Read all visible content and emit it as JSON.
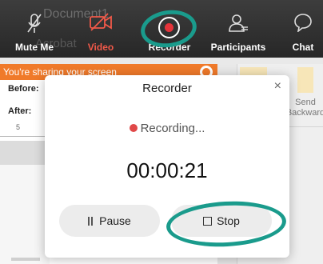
{
  "toolbar": {
    "ghost_title": "Document1",
    "ghost_sub": "Acrobat",
    "buttons": {
      "mute": "Mute Me",
      "video": "Video",
      "recorder": "Recorder",
      "participants": "Participants",
      "chat": "Chat"
    },
    "video_label_color": "#f15949",
    "highlight_color": "#1a9b8c"
  },
  "document": {
    "share_banner": "You're sharing your screen",
    "before_label": "Before:",
    "after_label": "After:",
    "ruler_number": "5",
    "send_backward": "Send Backward"
  },
  "recorder_dialog": {
    "title": "Recorder",
    "close_symbol": "×",
    "status": "Recording...",
    "status_color": "#e04848",
    "elapsed": "00:00:21",
    "pause_label": "Pause",
    "stop_label": "Stop"
  },
  "icons": [
    "mic-muted-icon",
    "video-off-icon",
    "record-icon",
    "participants-icon",
    "chat-icon",
    "pause-icon",
    "stop-icon",
    "close-icon"
  ]
}
